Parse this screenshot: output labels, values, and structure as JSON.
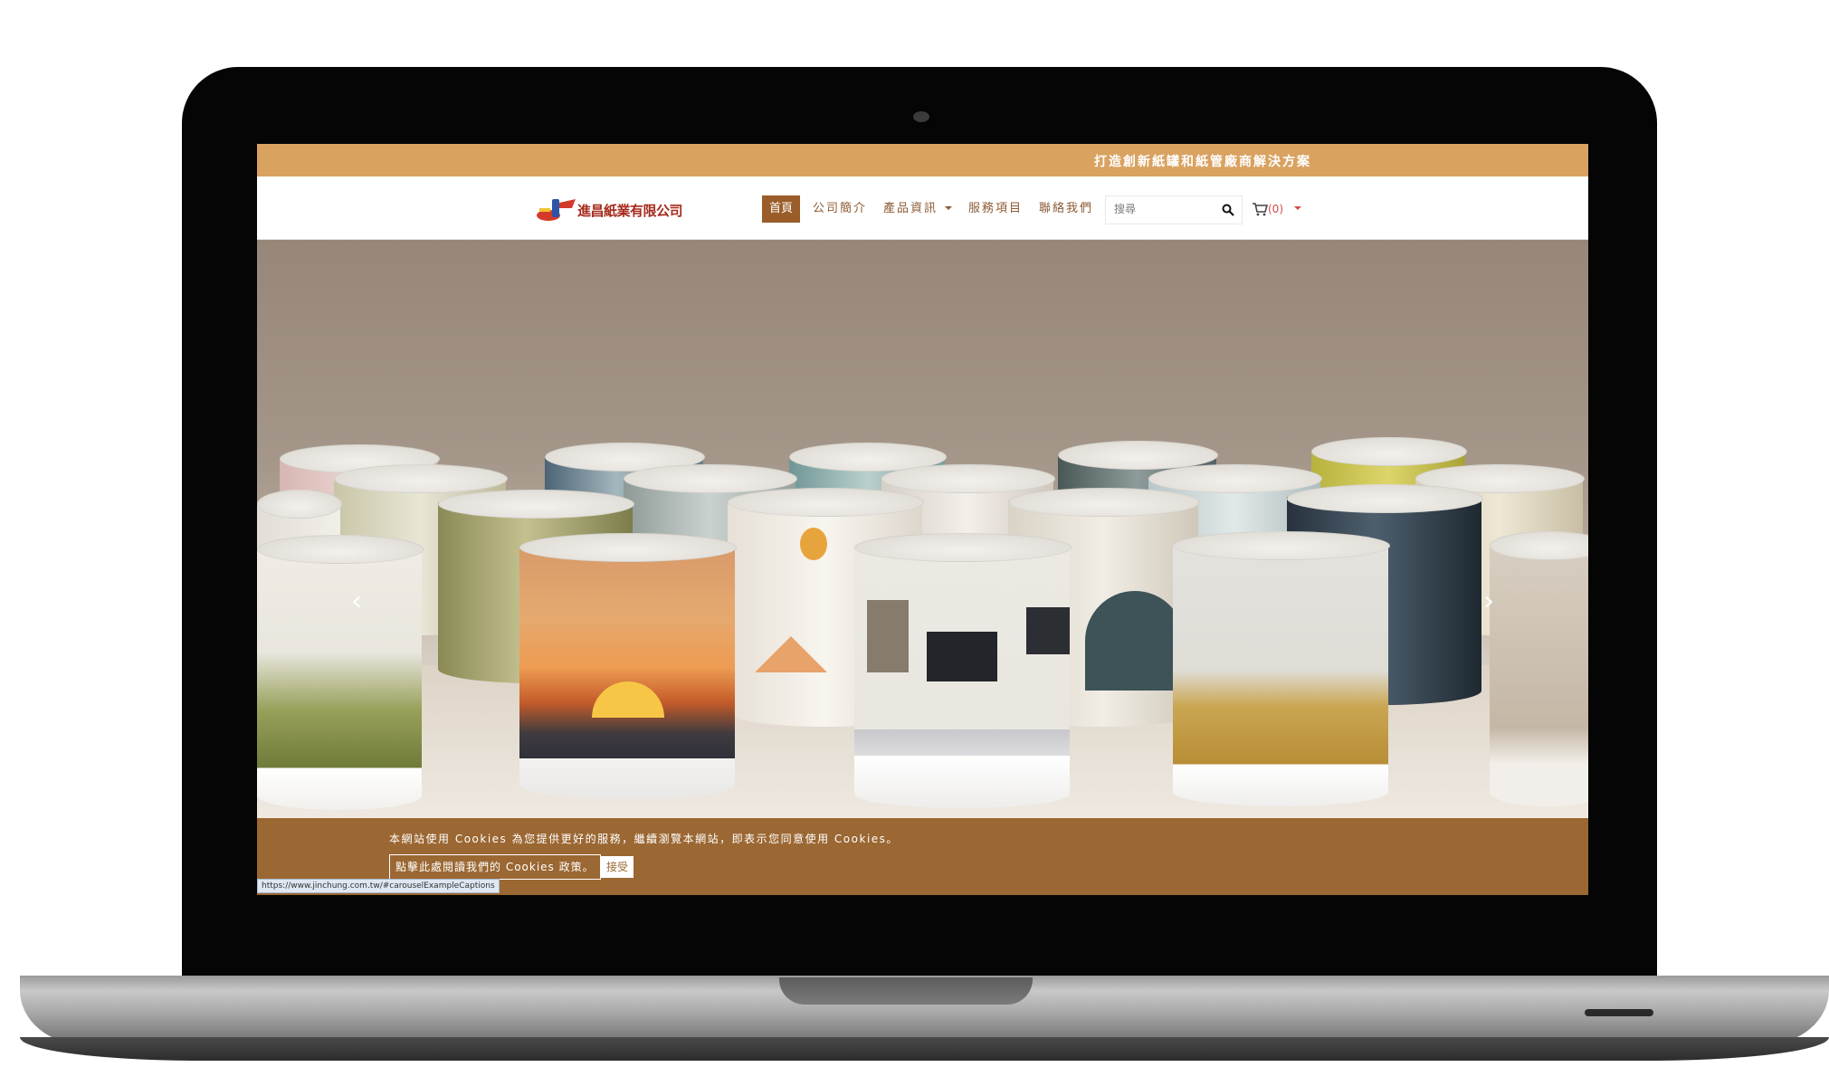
{
  "banner": {
    "tagline": "打造創新紙罐和紙管廠商解決方案"
  },
  "header": {
    "logo_text": "進昌紙業有限公司",
    "nav": {
      "home": "首頁",
      "about": "公司簡介",
      "products": "產品資訊",
      "services": "服務項目",
      "contact": "聯絡我們"
    },
    "search": {
      "placeholder": "搜尋"
    },
    "cart": {
      "count": "(0)"
    }
  },
  "carousel": {
    "prev": "‹",
    "next": "›"
  },
  "cookie": {
    "message": "本網站使用 Cookies 為您提供更好的服務，繼續瀏覽本網站，即表示您同意使用 Cookies。",
    "policy_link": "點擊此處閱讀我們的 Cookies 政策。",
    "accept": "接受"
  },
  "status_bar": {
    "url": "https://www.jinchung.com.tw/#carouselExampleCaptions"
  },
  "colors": {
    "banner": "#d9a260",
    "nav_active": "#9a5c28",
    "nav_text": "#8c5a33",
    "cookie_bar": "#9b6732",
    "cart_count": "#d24a4a"
  }
}
